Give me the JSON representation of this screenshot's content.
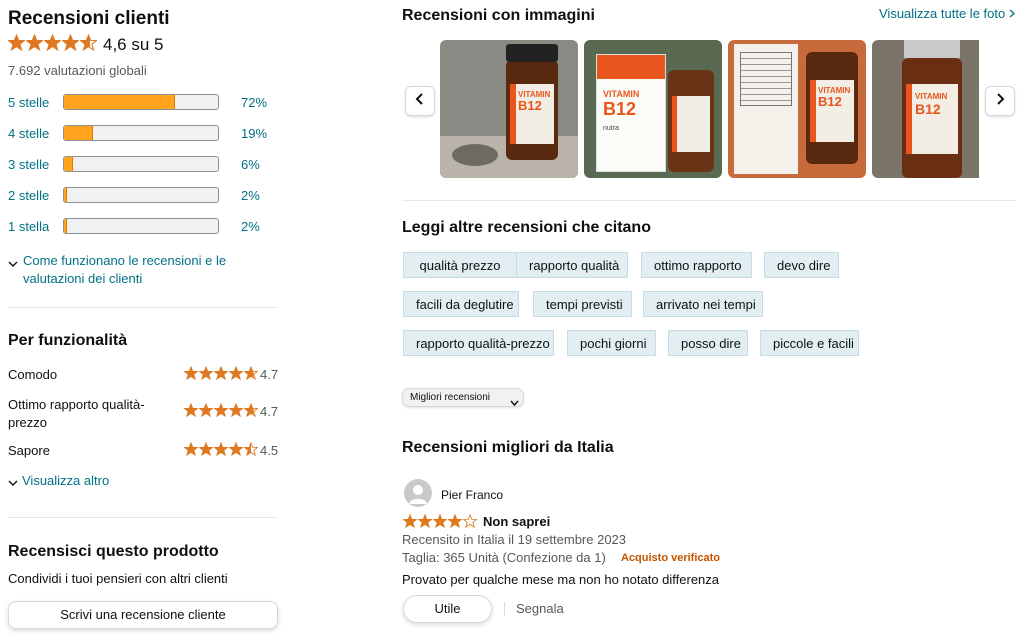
{
  "left": {
    "title": "Recensioni clienti",
    "rating_value": 4.6,
    "rating_text": "4,6 su 5",
    "global_ratings": "7.692 valutazioni globali",
    "histogram": [
      {
        "label": "5 stelle",
        "percent": 72,
        "pct_text": "72%"
      },
      {
        "label": "4 stelle",
        "percent": 19,
        "pct_text": "19%"
      },
      {
        "label": "3 stelle",
        "percent": 6,
        "pct_text": "6%"
      },
      {
        "label": "2 stelle",
        "percent": 2,
        "pct_text": "2%"
      },
      {
        "label": "1 stella",
        "percent": 2,
        "pct_text": "2%"
      }
    ],
    "how_it_works": "Come funzionano le recensioni e le valutazioni dei clienti",
    "features_title": "Per funzionalità",
    "features": [
      {
        "name": "Comodo",
        "rating": 4.7,
        "rating_text": "4.7"
      },
      {
        "name": "Ottimo rapporto qualità-prezzo",
        "rating": 4.7,
        "rating_text": "4.7"
      },
      {
        "name": "Sapore",
        "rating": 4.5,
        "rating_text": "4.5"
      }
    ],
    "see_more": "Visualizza altro",
    "review_title": "Recensisci questo prodotto",
    "review_sub": "Condividi i tuoi pensieri con altri clienti",
    "write_button": "Scrivi una recensione cliente"
  },
  "right": {
    "images_title": "Recensioni con immagini",
    "see_all_photos": "Visualizza tutte le foto",
    "photos": [
      {
        "label_line1": "VITAMIN",
        "label_line2": "B12"
      },
      {
        "label_line1": "VITAMIN",
        "label_line2": "B12"
      },
      {
        "label_line1": "VITAMIN",
        "label_line2": "B12"
      },
      {
        "label_line1": "VITAMIN",
        "label_line2": "B12"
      }
    ],
    "brand": "nutra",
    "mentions_title": "Leggi altre recensioni che citano",
    "chips": [
      [
        "qualità prezzo",
        "rapporto qualità",
        "ottimo rapporto",
        "devo dire"
      ],
      [
        "facili da deglutire",
        "tempi previsti",
        "arrivato nei tempi"
      ],
      [
        "rapporto qualità-prezzo",
        "pochi giorni",
        "posso dire",
        "piccole e facili"
      ]
    ],
    "sort_select": "Migliori recensioni",
    "top_reviews_title": "Recensioni migliori da Italia",
    "review": {
      "author": "Pier Franco",
      "stars": 4,
      "headline": "Non saprei",
      "date": "Recensito in Italia il 19 settembre 2023",
      "variant": "Taglia: 365 Unità (Confezione da 1)",
      "verified": "Acquisto verificato",
      "body": "Provato per qualche mese ma non ho notato differenza",
      "helpful_button": "Utile",
      "report": "Segnala"
    }
  },
  "colors": {
    "star": "#de7921",
    "bar": "#ffa41c",
    "link": "#007185",
    "verified": "#c45500",
    "chip_bg": "#e3eef2"
  }
}
